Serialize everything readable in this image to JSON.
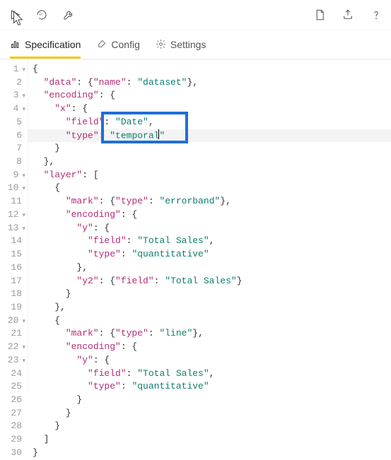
{
  "toolbar": {
    "icons": {
      "run": "run-icon",
      "refresh": "refresh-icon",
      "wrench": "wrench-icon",
      "newdoc": "new-document-icon",
      "export": "export-icon",
      "help": "help-icon"
    }
  },
  "tabs": {
    "spec": "Specification",
    "config": "Config",
    "settings": "Settings"
  },
  "highlight_line": 6,
  "box": {
    "top_line": 5,
    "left_ch": 14,
    "bottom_line": 6,
    "right_ch": 30
  },
  "code": {
    "lines": [
      {
        "n": 1,
        "fold": true,
        "tokens": [
          {
            "t": "{",
            "c": "p"
          }
        ]
      },
      {
        "n": 2,
        "fold": false,
        "tokens": [
          {
            "t": "  ",
            "c": "p"
          },
          {
            "t": "\"data\"",
            "c": "k"
          },
          {
            "t": ": {",
            "c": "p"
          },
          {
            "t": "\"name\"",
            "c": "k"
          },
          {
            "t": ": ",
            "c": "p"
          },
          {
            "t": "\"dataset\"",
            "c": "s"
          },
          {
            "t": "},",
            "c": "p"
          }
        ]
      },
      {
        "n": 3,
        "fold": true,
        "tokens": [
          {
            "t": "  ",
            "c": "p"
          },
          {
            "t": "\"encoding\"",
            "c": "k"
          },
          {
            "t": ": {",
            "c": "p"
          }
        ]
      },
      {
        "n": 4,
        "fold": true,
        "tokens": [
          {
            "t": "    ",
            "c": "p"
          },
          {
            "t": "\"x\"",
            "c": "k"
          },
          {
            "t": ": {",
            "c": "p"
          }
        ]
      },
      {
        "n": 5,
        "fold": false,
        "tokens": [
          {
            "t": "      ",
            "c": "p"
          },
          {
            "t": "\"field\"",
            "c": "k"
          },
          {
            "t": ": ",
            "c": "p"
          },
          {
            "t": "\"Date\"",
            "c": "s"
          },
          {
            "t": ",",
            "c": "p"
          }
        ]
      },
      {
        "n": 6,
        "fold": false,
        "tokens": [
          {
            "t": "      ",
            "c": "p"
          },
          {
            "t": "\"type\"",
            "c": "k"
          },
          {
            "t": ": ",
            "c": "p"
          },
          {
            "t": "\"temporal",
            "c": "s"
          },
          {
            "t": "",
            "c": "caret"
          },
          {
            "t": "\"",
            "c": "s"
          }
        ]
      },
      {
        "n": 7,
        "fold": false,
        "tokens": [
          {
            "t": "    }",
            "c": "p"
          }
        ]
      },
      {
        "n": 8,
        "fold": false,
        "tokens": [
          {
            "t": "  },",
            "c": "p"
          }
        ]
      },
      {
        "n": 9,
        "fold": true,
        "tokens": [
          {
            "t": "  ",
            "c": "p"
          },
          {
            "t": "\"layer\"",
            "c": "k"
          },
          {
            "t": ": [",
            "c": "p"
          }
        ]
      },
      {
        "n": 10,
        "fold": true,
        "tokens": [
          {
            "t": "    {",
            "c": "p"
          }
        ]
      },
      {
        "n": 11,
        "fold": false,
        "tokens": [
          {
            "t": "      ",
            "c": "p"
          },
          {
            "t": "\"mark\"",
            "c": "k"
          },
          {
            "t": ": {",
            "c": "p"
          },
          {
            "t": "\"type\"",
            "c": "k"
          },
          {
            "t": ": ",
            "c": "p"
          },
          {
            "t": "\"errorband\"",
            "c": "s"
          },
          {
            "t": "},",
            "c": "p"
          }
        ]
      },
      {
        "n": 12,
        "fold": true,
        "tokens": [
          {
            "t": "      ",
            "c": "p"
          },
          {
            "t": "\"encoding\"",
            "c": "k"
          },
          {
            "t": ": {",
            "c": "p"
          }
        ]
      },
      {
        "n": 13,
        "fold": true,
        "tokens": [
          {
            "t": "        ",
            "c": "p"
          },
          {
            "t": "\"y\"",
            "c": "k"
          },
          {
            "t": ": {",
            "c": "p"
          }
        ]
      },
      {
        "n": 14,
        "fold": false,
        "tokens": [
          {
            "t": "          ",
            "c": "p"
          },
          {
            "t": "\"field\"",
            "c": "k"
          },
          {
            "t": ": ",
            "c": "p"
          },
          {
            "t": "\"Total Sales\"",
            "c": "s"
          },
          {
            "t": ",",
            "c": "p"
          }
        ]
      },
      {
        "n": 15,
        "fold": false,
        "tokens": [
          {
            "t": "          ",
            "c": "p"
          },
          {
            "t": "\"type\"",
            "c": "k"
          },
          {
            "t": ": ",
            "c": "p"
          },
          {
            "t": "\"quantitative\"",
            "c": "s"
          }
        ]
      },
      {
        "n": 16,
        "fold": false,
        "tokens": [
          {
            "t": "        },",
            "c": "p"
          }
        ]
      },
      {
        "n": 17,
        "fold": false,
        "tokens": [
          {
            "t": "        ",
            "c": "p"
          },
          {
            "t": "\"y2\"",
            "c": "k"
          },
          {
            "t": ": {",
            "c": "p"
          },
          {
            "t": "\"field\"",
            "c": "k"
          },
          {
            "t": ": ",
            "c": "p"
          },
          {
            "t": "\"Total Sales\"",
            "c": "s"
          },
          {
            "t": "}",
            "c": "p"
          }
        ]
      },
      {
        "n": 18,
        "fold": false,
        "tokens": [
          {
            "t": "      }",
            "c": "p"
          }
        ]
      },
      {
        "n": 19,
        "fold": false,
        "tokens": [
          {
            "t": "    },",
            "c": "p"
          }
        ]
      },
      {
        "n": 20,
        "fold": true,
        "tokens": [
          {
            "t": "    {",
            "c": "p"
          }
        ]
      },
      {
        "n": 21,
        "fold": false,
        "tokens": [
          {
            "t": "      ",
            "c": "p"
          },
          {
            "t": "\"mark\"",
            "c": "k"
          },
          {
            "t": ": {",
            "c": "p"
          },
          {
            "t": "\"type\"",
            "c": "k"
          },
          {
            "t": ": ",
            "c": "p"
          },
          {
            "t": "\"line\"",
            "c": "s"
          },
          {
            "t": "},",
            "c": "p"
          }
        ]
      },
      {
        "n": 22,
        "fold": true,
        "tokens": [
          {
            "t": "      ",
            "c": "p"
          },
          {
            "t": "\"encoding\"",
            "c": "k"
          },
          {
            "t": ": {",
            "c": "p"
          }
        ]
      },
      {
        "n": 23,
        "fold": true,
        "tokens": [
          {
            "t": "        ",
            "c": "p"
          },
          {
            "t": "\"y\"",
            "c": "k"
          },
          {
            "t": ": {",
            "c": "p"
          }
        ]
      },
      {
        "n": 24,
        "fold": false,
        "tokens": [
          {
            "t": "          ",
            "c": "p"
          },
          {
            "t": "\"field\"",
            "c": "k"
          },
          {
            "t": ": ",
            "c": "p"
          },
          {
            "t": "\"Total Sales\"",
            "c": "s"
          },
          {
            "t": ",",
            "c": "p"
          }
        ]
      },
      {
        "n": 25,
        "fold": false,
        "tokens": [
          {
            "t": "          ",
            "c": "p"
          },
          {
            "t": "\"type\"",
            "c": "k"
          },
          {
            "t": ": ",
            "c": "p"
          },
          {
            "t": "\"quantitative\"",
            "c": "s"
          }
        ]
      },
      {
        "n": 26,
        "fold": false,
        "tokens": [
          {
            "t": "        }",
            "c": "p"
          }
        ]
      },
      {
        "n": 27,
        "fold": false,
        "tokens": [
          {
            "t": "      }",
            "c": "p"
          }
        ]
      },
      {
        "n": 28,
        "fold": false,
        "tokens": [
          {
            "t": "    }",
            "c": "p"
          }
        ]
      },
      {
        "n": 29,
        "fold": false,
        "tokens": [
          {
            "t": "  ]",
            "c": "p"
          }
        ]
      },
      {
        "n": 30,
        "fold": false,
        "tokens": [
          {
            "t": "}",
            "c": "p"
          }
        ]
      }
    ]
  }
}
